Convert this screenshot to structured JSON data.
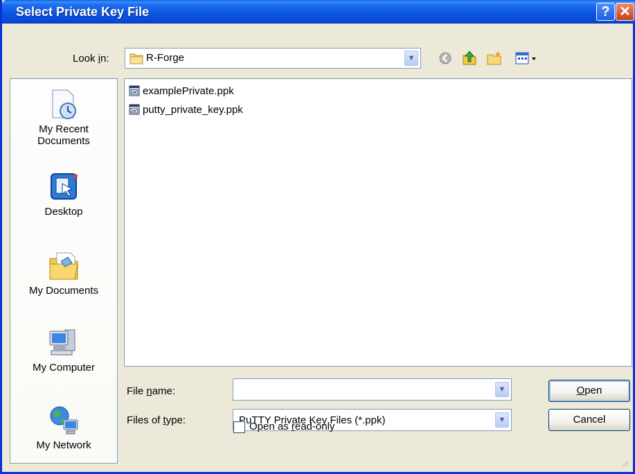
{
  "window": {
    "title": "Select Private Key File",
    "help_glyph": "?",
    "close_glyph": "✕"
  },
  "lookin": {
    "label_pre": "Look ",
    "label_ul": "i",
    "label_post": "n:",
    "value": "R-Forge"
  },
  "places": [
    {
      "label_line1": "My Recent",
      "label_line2": "Documents",
      "icon": "recent-documents-icon"
    },
    {
      "label_line1": "Desktop",
      "label_line2": "",
      "icon": "desktop-icon"
    },
    {
      "label_line1": "My Documents",
      "label_line2": "",
      "icon": "my-documents-icon"
    },
    {
      "label_line1": "My Computer",
      "label_line2": "",
      "icon": "my-computer-icon"
    },
    {
      "label_line1": "My Network",
      "label_line2": "",
      "icon": "my-network-icon"
    }
  ],
  "files": [
    {
      "name": "examplePrivate.ppk",
      "icon": "ppk-file-icon"
    },
    {
      "name": "putty_private_key.ppk",
      "icon": "ppk-file-icon"
    }
  ],
  "filename": {
    "label_pre": "File ",
    "label_ul": "n",
    "label_post": "ame:",
    "value": ""
  },
  "filetype": {
    "label_pre": "Files of ",
    "label_ul": "t",
    "label_post": "ype:",
    "value": "PuTTY Private Key Files (*.ppk)"
  },
  "readonly": {
    "label_pre": "Open as ",
    "label_ul": "r",
    "label_post": "ead-only",
    "checked": false
  },
  "buttons": {
    "open_ul": "O",
    "open_rest": "pen",
    "cancel": "Cancel"
  },
  "colors": {
    "titlebar": "#0a55df",
    "close": "#c8421f",
    "dialog_bg": "#ece9d8",
    "border": "#7f9db9"
  }
}
